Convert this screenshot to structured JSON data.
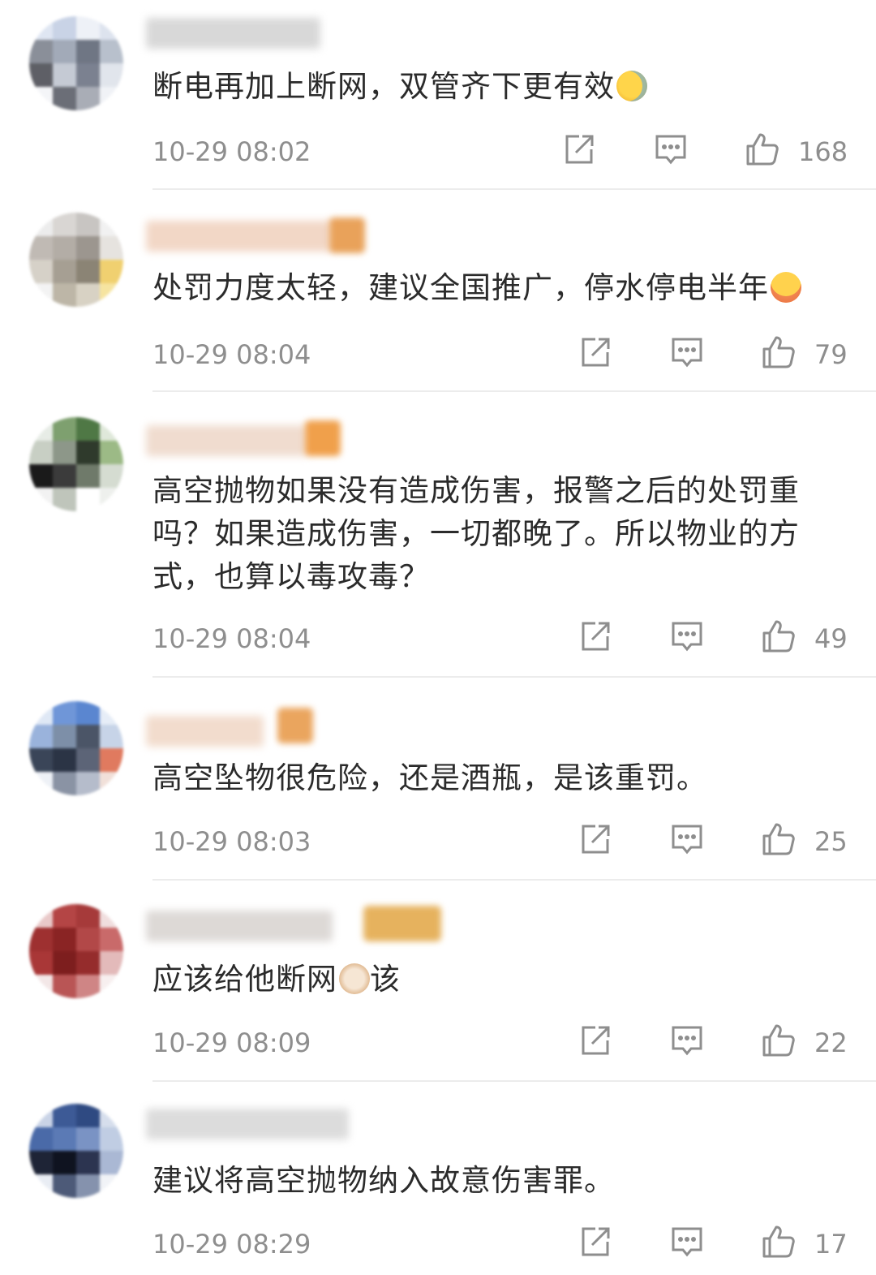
{
  "comments": [
    {
      "text": "断电再加上断网，双管齐下更有效",
      "emoji": "laughing-tears-emoji",
      "time": "10-29 08:02",
      "likes": "168"
    },
    {
      "text": "处罚力度太轻，建议全国推广，停水停电半年",
      "emoji": "yum-emoji",
      "time": "10-29 08:04",
      "likes": "79"
    },
    {
      "text": "高空抛物如果没有造成伤害，报警之后的处罚重吗？如果造成伤害，一切都晚了。所以物业的方式，也算以毒攻毒？",
      "emoji": "",
      "time": "10-29 08:04",
      "likes": "49"
    },
    {
      "text": "高空坠物很危险，还是酒瓶，是该重罚。",
      "emoji": "",
      "time": "10-29 08:03",
      "likes": "25"
    },
    {
      "text_before": "应该给他断网",
      "text_after": "该",
      "emoji": "cat-face-emoji",
      "time": "10-29 08:09",
      "likes": "22"
    },
    {
      "text": "建议将高空抛物纳入故意伤害罪。",
      "emoji": "",
      "time": "10-29 08:29",
      "likes": "17"
    }
  ],
  "icons": {
    "share": "share-icon",
    "reply": "comment-icon",
    "like": "thumbs-up-icon"
  },
  "colors": {
    "text": "#2b2b2b",
    "meta": "#8e8e8e",
    "divider": "#ececec"
  }
}
